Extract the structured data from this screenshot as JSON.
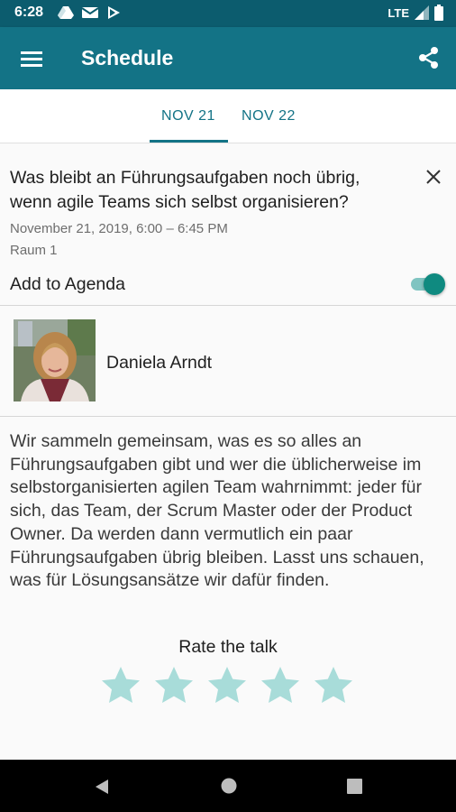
{
  "status_bar": {
    "time": "6:28",
    "network": "LTE"
  },
  "app_bar": {
    "title": "Schedule"
  },
  "tabs": [
    {
      "label": "NOV 21",
      "selected": true
    },
    {
      "label": "NOV 22",
      "selected": false
    }
  ],
  "session": {
    "title": "Was bleibt an Führungsaufgaben noch übrig, wenn agile Teams sich selbst organisieren?",
    "datetime": "November 21, 2019, 6:00 – 6:45 PM",
    "room": "Raum 1",
    "agenda_label": "Add to Agenda",
    "agenda_enabled": true
  },
  "speaker": {
    "name": "Daniela Arndt"
  },
  "description": "Wir sammeln gemeinsam, was es so alles an Führungsaufgaben gibt und wer die üblicherweise im selbstorganisierten agilen Team wahrnimmt: jeder für sich, das Team, der Scrum Master oder der Product Owner. Da werden dann vermutlich ein paar Führungsaufgaben übrig bleiben. Lasst uns schauen, was für Lösungsansätze wir dafür finden.",
  "rating": {
    "label": "Rate the talk",
    "max": 5,
    "value": 0
  },
  "colors": {
    "primary": "#137386",
    "status_bar": "#0c5c6e",
    "accent": "#0f8a80",
    "star": "#a8dcd9"
  }
}
